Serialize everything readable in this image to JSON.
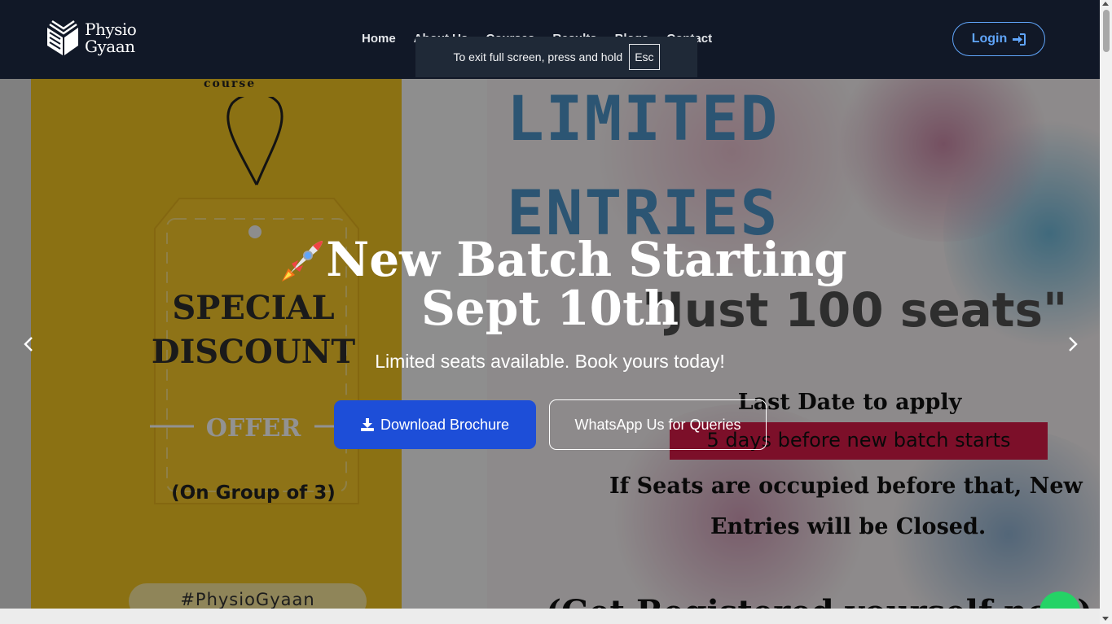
{
  "brand": {
    "line1": "Physio",
    "line2": "Gyaan",
    "icon": "open-book-logo"
  },
  "nav": {
    "items": [
      {
        "label": "Home"
      },
      {
        "label": "About Us"
      },
      {
        "label": "Courses"
      },
      {
        "label": "Results"
      },
      {
        "label": "Blogs"
      },
      {
        "label": "Contact"
      }
    ],
    "login_label": "Login",
    "login_icon": "sign-in-icon"
  },
  "fullscreen_notice": {
    "text": "To exit full screen, press and hold",
    "key": "Esc"
  },
  "hero": {
    "headline_line1": "New Batch Starting",
    "headline_line2": "Sept 10th",
    "headline_icon": "rocket-emoji",
    "subtitle": "Limited seats available. Book yours today!",
    "download_label": "Download Brochure",
    "download_icon": "download-icon",
    "whatsapp_label": "WhatsApp Us for Queries",
    "prev_icon": "chevron-left-icon",
    "next_icon": "chevron-right-icon"
  },
  "poster": {
    "course_word": "course",
    "special": "SPECIAL",
    "discount": "DISCOUNT",
    "offer": "OFFER",
    "group": "(On Group of 3)",
    "hashtag": "#PhysioGyaan",
    "limited": "LIMITED",
    "entries": "ENTRIES",
    "seats": "\"Just 100 seats\"",
    "last_date": "Last Date to apply",
    "deadline": "5 days before new batch starts",
    "occupied": "If Seats are occupied before that, New",
    "closed": "Entries will be Closed.",
    "bottom_line": "(Get Registered yourself now)"
  },
  "colors": {
    "navbar_bg": "#111827",
    "accent_blue": "#1d4ed8",
    "login_outline": "#60a5fa",
    "poster_yellow": "#f0c321",
    "poster_red": "#d61a47",
    "whatsapp_green": "#25d366"
  }
}
